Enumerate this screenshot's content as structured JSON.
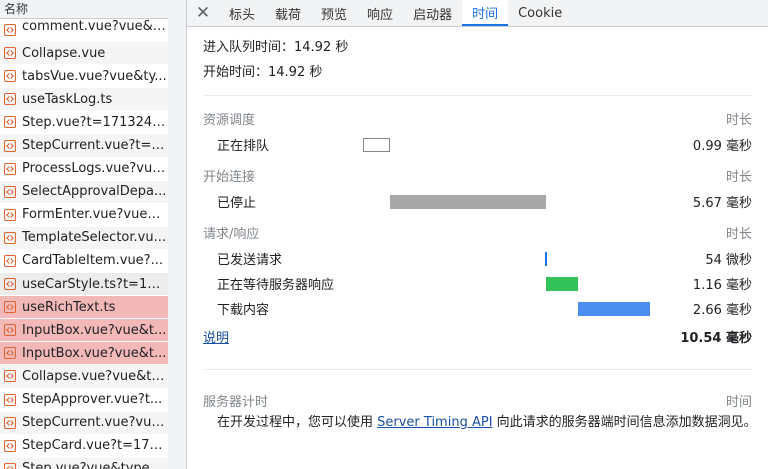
{
  "list": {
    "header": "名称",
    "items": [
      {
        "name": "comment.vue?vue&t...",
        "state": ""
      },
      {
        "name": "Collapse.vue",
        "state": ""
      },
      {
        "name": "tabsVue.vue?vue&ty...",
        "state": ""
      },
      {
        "name": "useTaskLog.ts",
        "state": ""
      },
      {
        "name": "Step.vue?t=1713249...",
        "state": ""
      },
      {
        "name": "StepCurrent.vue?t=1...",
        "state": ""
      },
      {
        "name": "ProcessLogs.vue?vue...",
        "state": ""
      },
      {
        "name": "SelectApprovalDepa...",
        "state": ""
      },
      {
        "name": "FormEnter.vue?vue&...",
        "state": ""
      },
      {
        "name": "TemplateSelector.vu...",
        "state": ""
      },
      {
        "name": "CardTableItem.vue?...",
        "state": ""
      },
      {
        "name": "useCarStyle.ts?t=171...",
        "state": "hl"
      },
      {
        "name": "useRichText.ts",
        "state": "err"
      },
      {
        "name": "InputBox.vue?vue&t...",
        "state": "err"
      },
      {
        "name": "InputBox.vue?vue&t...",
        "state": "err"
      },
      {
        "name": "Collapse.vue?vue&ty...",
        "state": ""
      },
      {
        "name": "StepApprover.vue?t...",
        "state": ""
      },
      {
        "name": "StepCurrent.vue?vue...",
        "state": ""
      },
      {
        "name": "StepCard.vue?t=171...",
        "state": ""
      },
      {
        "name": "Step.vue?vue&type=...",
        "state": ""
      }
    ]
  },
  "tabs": {
    "close": "✕",
    "items": [
      "标头",
      "载荷",
      "预览",
      "响应",
      "启动器",
      "时间",
      "Cookie"
    ],
    "active_index": 5
  },
  "timing": {
    "queued_label": "进入队列时间：14.92 秒",
    "started_label": "开始时间：14.92 秒",
    "duration_header": "时长",
    "sections": [
      {
        "title": "资源调度",
        "rows": [
          {
            "label": "正在排队",
            "duration": "0.99 毫秒",
            "bar": {
              "start": 0.0,
              "width": 0.09,
              "color": "#ffffff",
              "outline": true
            }
          }
        ]
      },
      {
        "title": "开始连接",
        "rows": [
          {
            "label": "已停止",
            "duration": "5.67 毫秒",
            "bar": {
              "start": 0.09,
              "width": 0.52,
              "color": "#a8a8a8",
              "outline": false
            }
          }
        ]
      },
      {
        "title": "请求/响应",
        "rows": [
          {
            "label": "已发送请求",
            "duration": "54 微秒",
            "bar": {
              "start": 0.606,
              "width": 0.005,
              "color": "#1a73e8",
              "outline": false
            }
          },
          {
            "label": "正在等待服务器响应",
            "duration": "1.16 毫秒",
            "bar": {
              "start": 0.611,
              "width": 0.107,
              "color": "#34c35a",
              "outline": false
            }
          },
          {
            "label": "下载内容",
            "duration": "2.66 毫秒",
            "bar": {
              "start": 0.718,
              "width": 0.24,
              "color": "#4c8ef0",
              "outline": false
            }
          }
        ]
      }
    ],
    "explain_link": "说明",
    "total": "10.54 毫秒",
    "server": {
      "title": "服务器计时",
      "header_right": "时间",
      "text_before": "在开发过程中，您可以使用 ",
      "link": "Server Timing API",
      "text_after": " 向此请求的服务器端时间信息添加数据洞见。"
    }
  }
}
